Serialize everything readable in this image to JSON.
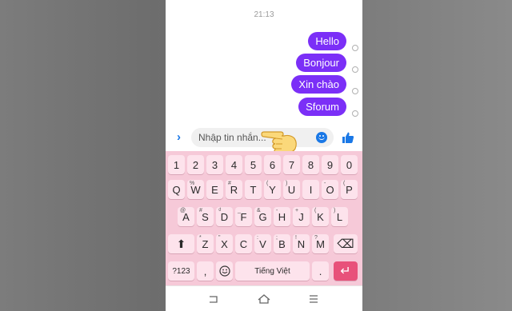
{
  "status": {
    "time": "21:13"
  },
  "messages": [
    {
      "text": "Hello"
    },
    {
      "text": "Bonjour"
    },
    {
      "text": "Xin chào"
    },
    {
      "text": "Sforum"
    }
  ],
  "composer": {
    "placeholder": "Nhập tin nhắn..."
  },
  "keyboard": {
    "number_row": [
      "1",
      "2",
      "3",
      "4",
      "5",
      "6",
      "7",
      "8",
      "9",
      "0"
    ],
    "row1": [
      {
        "key": "Q",
        "sub": ""
      },
      {
        "key": "W",
        "sub": "%"
      },
      {
        "key": "E",
        "sub": ""
      },
      {
        "key": "R",
        "sub": "#"
      },
      {
        "key": "T",
        "sub": ""
      },
      {
        "key": "Y",
        "sub": "("
      },
      {
        "key": "U",
        "sub": ")"
      },
      {
        "key": "I",
        "sub": ""
      },
      {
        "key": "O",
        "sub": "-"
      },
      {
        "key": "P",
        "sub": "("
      }
    ],
    "row2": [
      {
        "key": "A",
        "sub": "@"
      },
      {
        "key": "S",
        "sub": "#"
      },
      {
        "key": "D",
        "sub": "₫"
      },
      {
        "key": "F",
        "sub": "_"
      },
      {
        "key": "G",
        "sub": "&"
      },
      {
        "key": "H",
        "sub": "-"
      },
      {
        "key": "J",
        "sub": "+"
      },
      {
        "key": "K",
        "sub": "("
      },
      {
        "key": "L",
        "sub": ")"
      }
    ],
    "row3": [
      {
        "key": "Z",
        "sub": "*"
      },
      {
        "key": "X",
        "sub": "\""
      },
      {
        "key": "C",
        "sub": ""
      },
      {
        "key": "V",
        "sub": ":"
      },
      {
        "key": "B",
        "sub": ";"
      },
      {
        "key": "N",
        "sub": "!"
      },
      {
        "key": "M",
        "sub": "?"
      }
    ],
    "symbols_label": "?123",
    "comma": ",",
    "space_label": "Tiếng Việt",
    "period": ".",
    "enter_symbol": "↵",
    "backspace_symbol": "⌫",
    "shift_symbol": "⬆"
  },
  "colors": {
    "bubble": "#7b2ff7",
    "accent": "#1a78e6",
    "keyboard_bg": "#f6c9d8",
    "key_bg": "#fde3ec",
    "enter_bg": "#e8517a"
  }
}
